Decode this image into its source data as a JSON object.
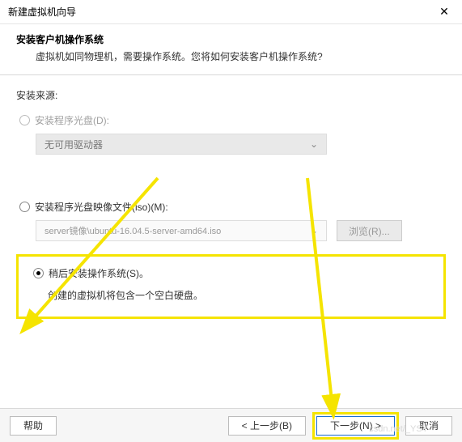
{
  "window": {
    "title": "新建虚拟机向导",
    "close_icon": "✕"
  },
  "header": {
    "title": "安装客户机操作系统",
    "desc": "虚拟机如同物理机，需要操作系统。您将如何安装客户机操作系统?"
  },
  "source_label": "安装来源:",
  "opt_disc": {
    "label": "安装程序光盘(D):",
    "select_text": "无可用驱动器",
    "chev": "⌄"
  },
  "opt_iso": {
    "label": "安装程序光盘映像文件(iso)(M):",
    "path": "server镜像\\ubuntu-16.04.5-server-amd64.iso",
    "chev": "⌄",
    "browse": "浏览(R)..."
  },
  "opt_later": {
    "label": "稍后安装操作系统(S)。",
    "desc": "创建的虚拟机将包含一个空白硬盘。"
  },
  "footer": {
    "help": "帮助",
    "back": "< 上一步(B)",
    "next": "下一步(N) >",
    "cancel": "取消"
  },
  "watermark": "csdn.net/_YSY"
}
